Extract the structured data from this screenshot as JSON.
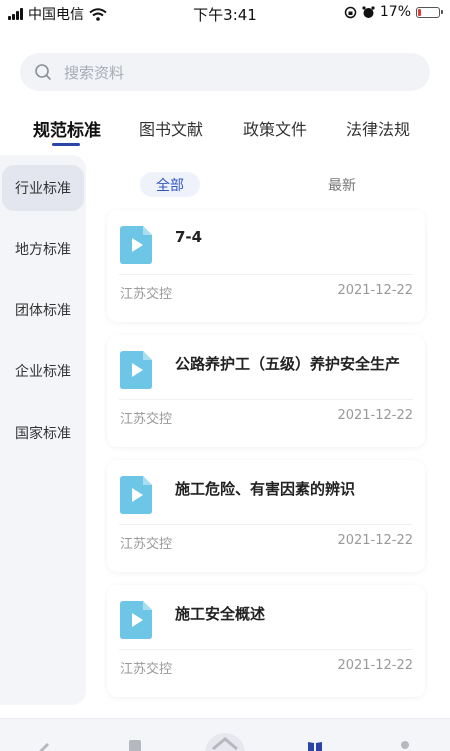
{
  "status_bar": {
    "carrier": "中国电信",
    "time": "下午3:41",
    "battery_percent_label": "17%",
    "battery_level": 0.17,
    "battery_color": "#e53935"
  },
  "search": {
    "placeholder": "搜索资料",
    "icon": "search-icon"
  },
  "tabs": [
    {
      "label": "规范标准",
      "active": true
    },
    {
      "label": "图书文献",
      "active": false
    },
    {
      "label": "政策文件",
      "active": false
    },
    {
      "label": "法律法规",
      "active": false
    }
  ],
  "side_nav": [
    {
      "label": "行业标准",
      "active": true
    },
    {
      "label": "地方标准",
      "active": false
    },
    {
      "label": "团体标准",
      "active": false
    },
    {
      "label": "企业标准",
      "active": false
    },
    {
      "label": "国家标准",
      "active": false
    }
  ],
  "sub_tabs": [
    {
      "label": "全部",
      "active": true
    },
    {
      "label": "最新",
      "active": false
    }
  ],
  "items": [
    {
      "title": "7-4",
      "source": "江苏交控",
      "date": "2021-12-22",
      "icon": "video-file-icon"
    },
    {
      "title": "公路养护工（五级）养护安全生产",
      "source": "江苏交控",
      "date": "2021-12-22",
      "icon": "video-file-icon"
    },
    {
      "title": "施工危险、有害因素的辨识",
      "source": "江苏交控",
      "date": "2021-12-22",
      "icon": "video-file-icon"
    },
    {
      "title": "施工安全概述",
      "source": "江苏交控",
      "date": "2021-12-22",
      "icon": "video-file-icon"
    }
  ],
  "colors": {
    "accent": "#2b44a8",
    "file_icon": "#6ec6e6",
    "subtab_active_text": "#3555c4"
  }
}
